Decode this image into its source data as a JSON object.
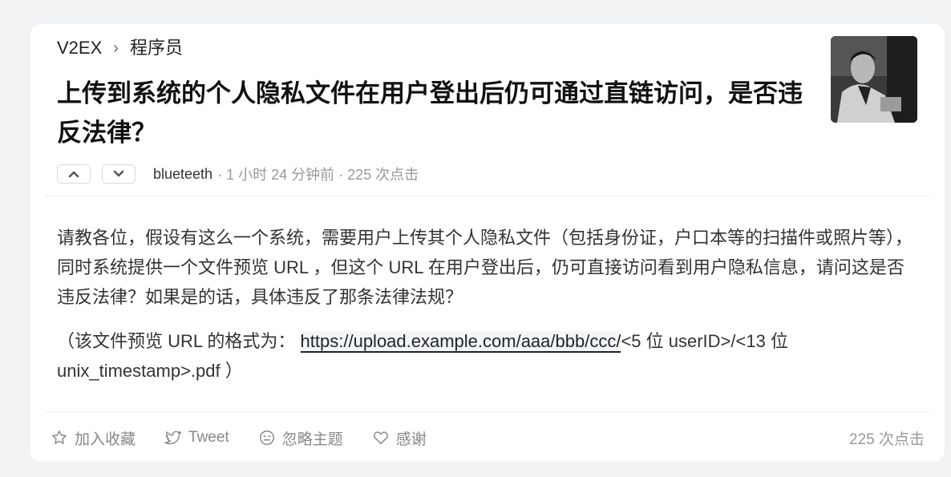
{
  "breadcrumb": {
    "site": "V2EX",
    "separator": "›",
    "node": "程序员"
  },
  "topic": {
    "title": "上传到系统的个人隐私文件在用户登出后仍可通过直链访问，是否违反法律？",
    "author": "blueteeth",
    "meta": "· 1 小时 24 分钟前 · 225 次点击"
  },
  "body": {
    "paragraph1": "请教各位，假设有这么一个系统，需要用户上传其个人隐私文件（包括身份证，户口本等的扫描件或照片等），同时系统提供一个文件预览 URL ，但这个 URL 在用户登出后，仍可直接访问看到用户隐私信息，请问这是否违反法律？如果是的话，具体违反了那条法律法规？",
    "paragraph2_prefix": "（该文件预览 URL 的格式为：",
    "paragraph2_link": "https://upload.example.com/aaa/bbb/ccc/",
    "paragraph2_suffix": "<5 位 userID>/<13 位 unix_timestamp>.pdf ）"
  },
  "footer": {
    "favorite": "加入收藏",
    "tweet": "Tweet",
    "ignore": "忽略主题",
    "thanks": "感谢",
    "clicks": "225 次点击"
  },
  "icons": {
    "upvote": "chevron-up-icon",
    "downvote": "chevron-down-icon",
    "favorite": "star-icon",
    "tweet": "twitter-bird-icon",
    "ignore": "ignore-face-icon",
    "thanks": "heart-icon"
  }
}
